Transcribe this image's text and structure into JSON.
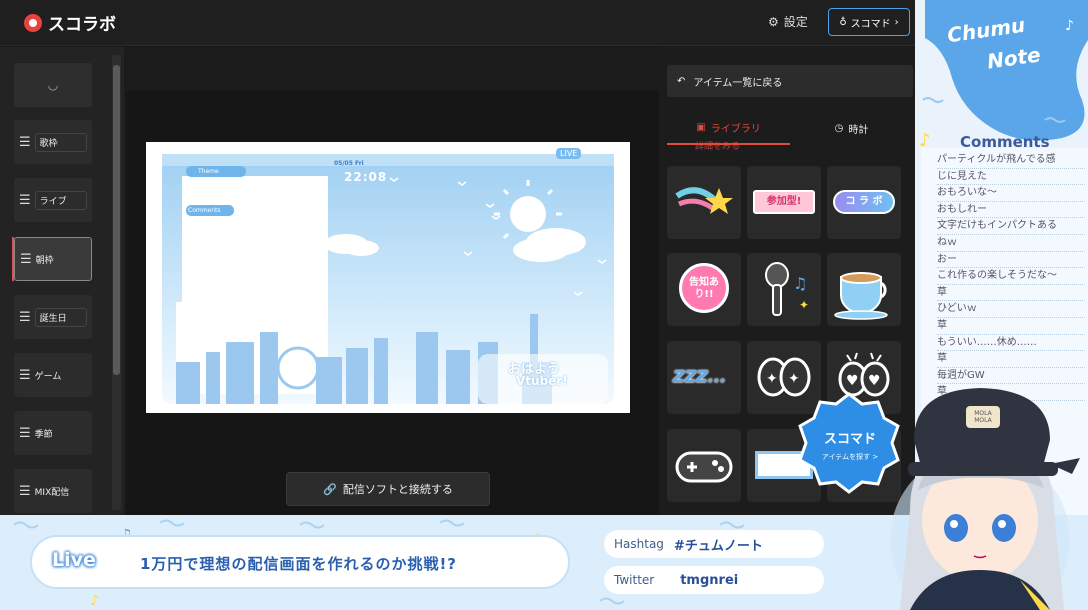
{
  "app": {
    "name": "スコラボ",
    "settings_label": "設定",
    "scomado_button": "スコマド"
  },
  "sidebar": {
    "items": [
      {
        "label": "歌枠"
      },
      {
        "label": "ライブ"
      },
      {
        "label": "朝枠"
      },
      {
        "label": "誕生日"
      },
      {
        "label": "ゲーム"
      },
      {
        "label": "季節"
      },
      {
        "label": "MIX配信"
      }
    ]
  },
  "preview": {
    "theme_label": "Theme",
    "comments_label": "Comments",
    "date": "05/05 Fri",
    "time": "22:08",
    "live_badge": "LIVE",
    "ohayou": "おはよう",
    "vtuber": "Vtuber!"
  },
  "canvas": {
    "connect_button": "配信ソフトと接続する"
  },
  "right_panel": {
    "back_button": "アイテム一覧に戻る",
    "tabs": [
      {
        "label": "ライブラリ"
      },
      {
        "label": "時計"
      }
    ],
    "hint": "詳細をみる",
    "stickers": {
      "sanka": "参加型!",
      "collabo": "コ ラ ボ",
      "kokuchi": "告知あり!!",
      "zzz": "ZZZ..."
    },
    "promo_title": "スコマド",
    "promo_sub": "アイテムを探す >"
  },
  "chat": {
    "logo_line1": "Chumu",
    "logo_line2": "Note",
    "comments_title": "Comments",
    "comments": [
      "パーティクルが飛んでる感",
      "じに見えた",
      "おもろいな〜",
      "おもしれー",
      "文字だけもインパクトある",
      "ねｗ",
      "おー",
      "これ作るの楽しそうだな〜",
      "草",
      "ひどいｗ",
      "草",
      "もういい……休め……",
      "草",
      "毎週がGW",
      "草"
    ]
  },
  "footer": {
    "live_label": "Live",
    "stream_title": "1万円で理想の配信画面を作れるのか挑戦!?",
    "hashtag_label": "Hashtag",
    "hashtag_value": "#チュムノート",
    "twitter_label": "Twitter",
    "twitter_value": "tmgnrei",
    "cap_text": "MOLA MOLA"
  }
}
